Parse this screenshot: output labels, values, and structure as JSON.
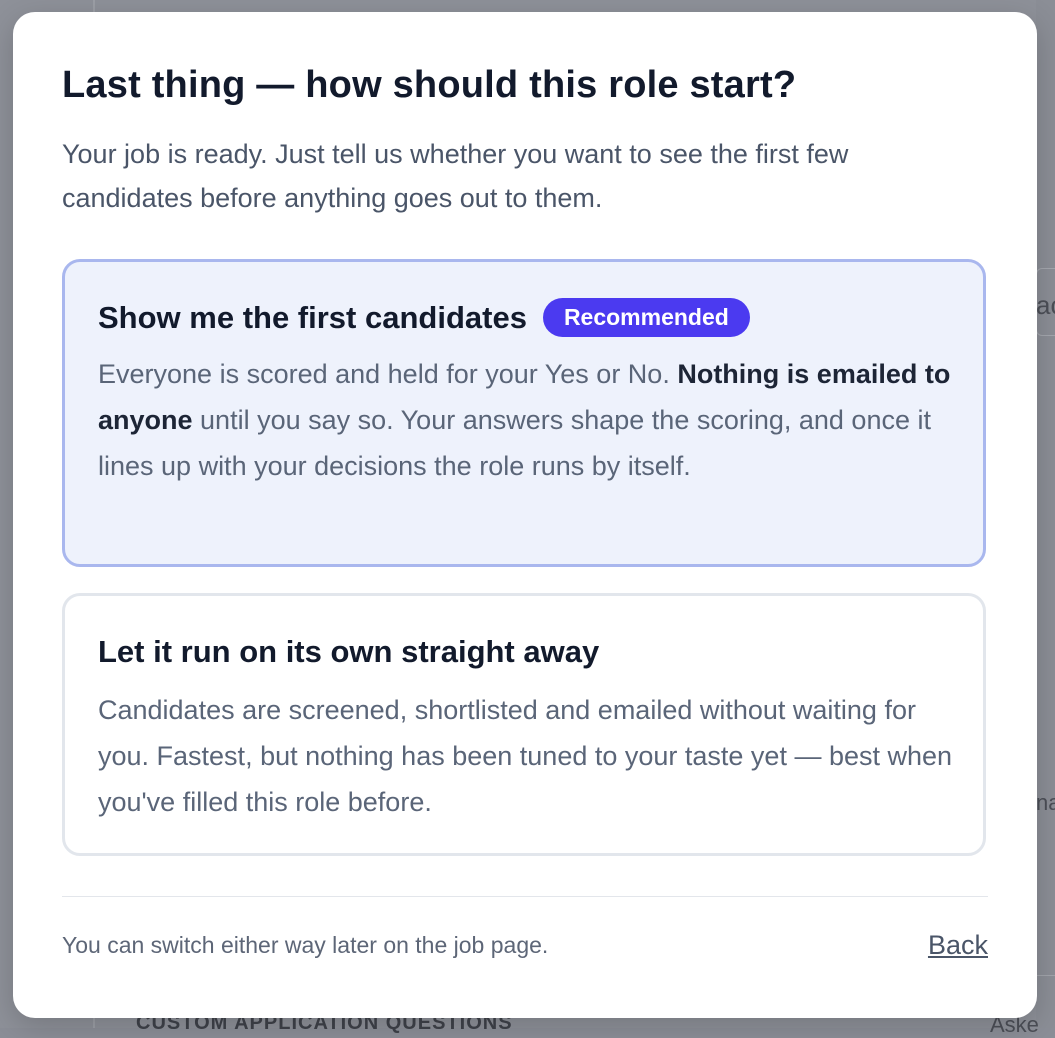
{
  "background": {
    "fragment_a": "ac",
    "fragment_b": "na",
    "fragment_c": "Aske",
    "section_label": "CUSTOM APPLICATION QUESTIONS"
  },
  "modal": {
    "title": "Last thing — how should this role start?",
    "subtitle": "Your job is ready. Just tell us whether you want to see the first few candidates before anything goes out to them.",
    "options": [
      {
        "title": "Show me the first candidates",
        "badge": "Recommended",
        "selected": true,
        "desc_before": "Everyone is scored and held for your Yes or No. ",
        "desc_bold": "Nothing is emailed to anyone",
        "desc_after": " until you say so. Your answers shape the scoring, and once it lines up with your decisions the role runs by itself."
      },
      {
        "title": "Let it run on its own straight away",
        "selected": false,
        "desc": "Candidates are screened, shortlisted and emailed without waiting for you. Fastest, but nothing has been tuned to your taste yet — best when you've filled this role before."
      }
    ],
    "footer_note": "You can switch either way later on the job page.",
    "back_label": "Back"
  },
  "colors": {
    "accent": "#4b3af0",
    "selected_bg": "#eef2fc",
    "selected_border": "#a9b7ee",
    "title_text": "#121a2c",
    "body_text": "#5a6578"
  }
}
